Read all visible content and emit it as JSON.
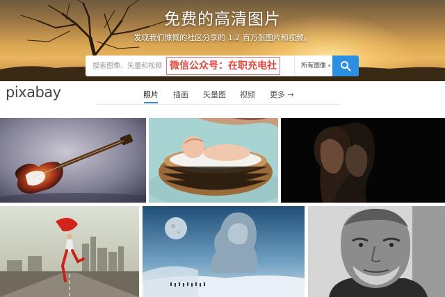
{
  "hero": {
    "title": "免费的高清图片",
    "subtitle": "发现我们慷慨的社区分享的 1.2 百万张图片和视频。"
  },
  "search": {
    "placeholder": "搜索图像、矢量和视频",
    "watermark": "微信公众号：在职充电社",
    "type_select": "所有图像",
    "button_icon": "search-icon"
  },
  "nav": {
    "logo": "pixabay",
    "tabs": [
      {
        "label": "照片",
        "active": true
      },
      {
        "label": "插画",
        "active": false
      },
      {
        "label": "矢量图",
        "active": false
      },
      {
        "label": "视频",
        "active": false
      },
      {
        "label": "更多 →",
        "active": false
      }
    ]
  },
  "colors": {
    "accent": "#2d8fe0",
    "watermark": "#e2473e"
  },
  "gallery": [
    {
      "subject": "electric-guitar"
    },
    {
      "subject": "baby-in-basket"
    },
    {
      "subject": "couple-silhouette"
    },
    {
      "subject": "dancer-with-red-scarf"
    },
    {
      "subject": "stone-giant-fantasy"
    },
    {
      "subject": "old-man-portrait"
    }
  ]
}
